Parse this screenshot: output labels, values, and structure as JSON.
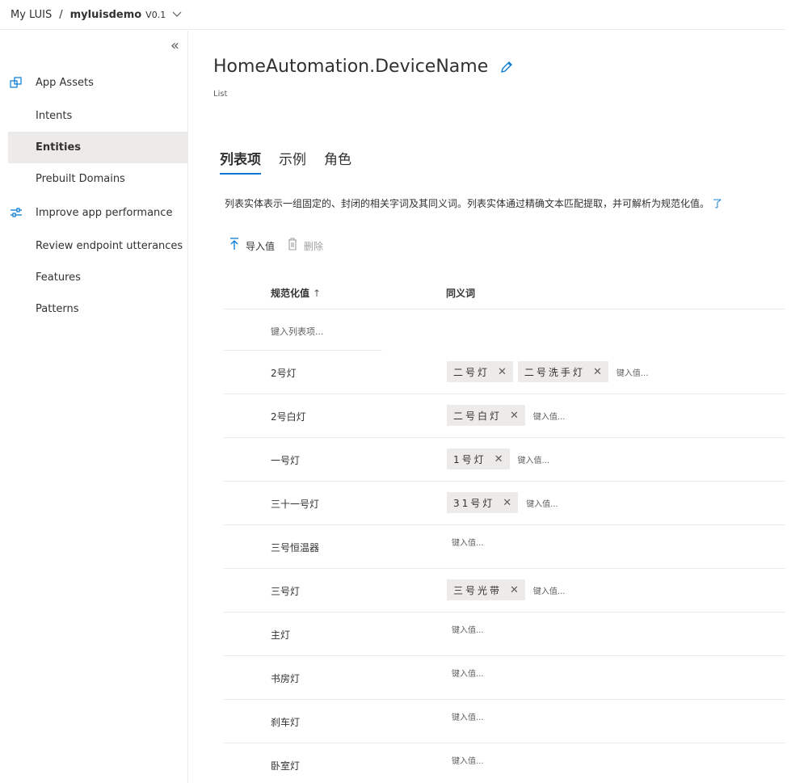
{
  "breadcrumb": {
    "root": "My LUIS",
    "separator": "/",
    "app": "myluisdemo",
    "version": "V0.1"
  },
  "sidebar": {
    "items": [
      {
        "label": "App Assets",
        "icon": "app-assets-icon"
      },
      {
        "label": "Intents"
      },
      {
        "label": "Entities"
      },
      {
        "label": "Prebuilt Domains"
      },
      {
        "label": "Improve app performance",
        "icon": "sliders-icon"
      },
      {
        "label": "Review endpoint utterances"
      },
      {
        "label": "Features"
      },
      {
        "label": "Patterns"
      }
    ],
    "active": "Entities"
  },
  "entity": {
    "name": "HomeAutomation.DeviceName",
    "type": "List"
  },
  "tabs": [
    "列表项",
    "示例",
    "角色"
  ],
  "description": "列表实体表示一组固定的、封闭的相关字词及其同义词。列表实体通过精确文本匹配提取，并可解析为规范化值。",
  "toolbar": {
    "import_label": "导入值",
    "delete_label": "删除"
  },
  "table": {
    "col_normalized": "规范化值",
    "sort_arrow": "↑",
    "col_synonyms": "同义词",
    "new_item_placeholder": "键入列表项...",
    "synonym_placeholder": "键入值...",
    "rows": [
      {
        "value": "2号灯",
        "synonyms": [
          "二号灯",
          "二号洗手灯"
        ]
      },
      {
        "value": "2号白灯",
        "synonyms": [
          "二号白灯"
        ]
      },
      {
        "value": "一号灯",
        "synonyms": [
          "1号灯"
        ]
      },
      {
        "value": "三十一号灯",
        "synonyms": [
          "31号灯"
        ]
      },
      {
        "value": "三号恒温器",
        "synonyms": []
      },
      {
        "value": "三号灯",
        "synonyms": [
          "三号光带"
        ]
      },
      {
        "value": "主灯",
        "synonyms": []
      },
      {
        "value": "书房灯",
        "synonyms": []
      },
      {
        "value": "刹车灯",
        "synonyms": []
      },
      {
        "value": "卧室灯",
        "synonyms": []
      }
    ]
  },
  "colors": {
    "accent": "#0078d4",
    "chip_bg": "#edebe9",
    "active_nav_bg": "#edebe9"
  }
}
